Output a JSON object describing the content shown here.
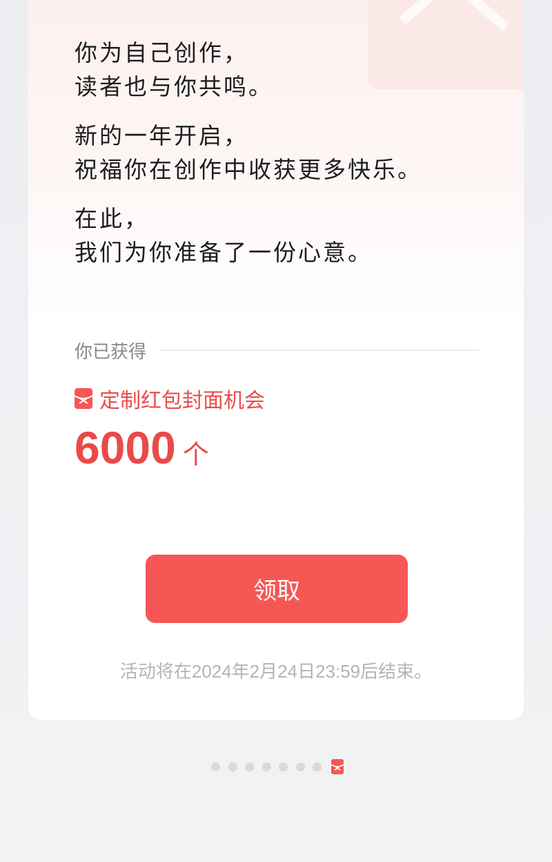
{
  "poem": {
    "stanza1": {
      "line1": "你为自己创作，",
      "line2": "读者也与你共鸣。"
    },
    "stanza2": {
      "line1": "新的一年开启，",
      "line2": "祝福你在创作中收获更多快乐。"
    },
    "stanza3": {
      "line1": "在此，",
      "line2": "我们为你准备了一份心意。"
    }
  },
  "reward": {
    "section_label": "你已获得",
    "title": "定制红包封面机会",
    "icon": "red-envelope-icon",
    "count": "6000",
    "unit": "个"
  },
  "claim_button": {
    "label": "领取"
  },
  "end_note": "活动将在2024年2月24日23:59后结束。",
  "pager": {
    "total_pages": 8,
    "current_page": 8,
    "current_icon": "red-envelope-icon"
  },
  "colors": {
    "accent": "#f65755",
    "accent_text": "#e94a48",
    "muted_text": "#b4b4b4"
  }
}
